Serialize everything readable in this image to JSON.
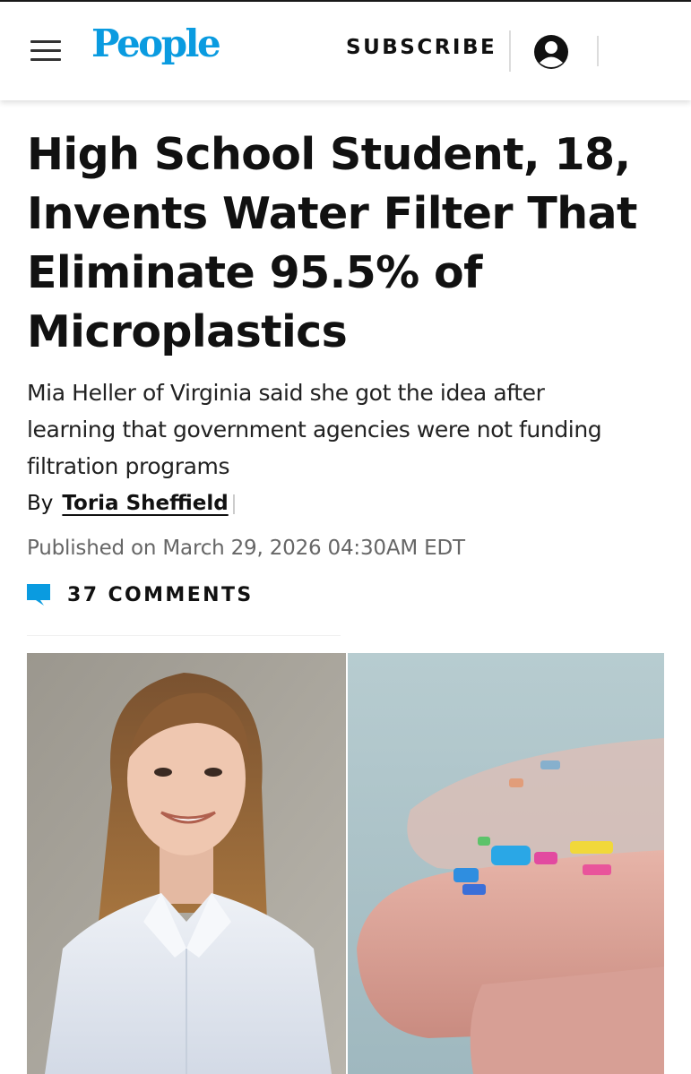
{
  "header": {
    "logo": "People",
    "subscribe_label": "SUBSCRIBE",
    "menu_icon": "hamburger-menu-icon",
    "account_icon": "account-circle-icon",
    "brand_color": "#0a9be0"
  },
  "article": {
    "headline_lines": [
      "High School Student, 18,",
      "Invents Water Filter That",
      "Eliminate 95.5% of",
      "Microplastics"
    ],
    "dek_lines": [
      "Mia Heller of Virginia said she got the idea after",
      "learning that government agencies were not funding",
      "filtration programs"
    ],
    "byline_prefix": "By",
    "author": "Toria Sheffield",
    "published": "Published on March 29, 2026 04:30AM EDT",
    "comments_label": "37  COMMENTS",
    "comments_icon": "comment-bubble-icon"
  },
  "images": {
    "left": "student-portrait-photo",
    "right": "microplastics-on-fingertip-photo"
  }
}
